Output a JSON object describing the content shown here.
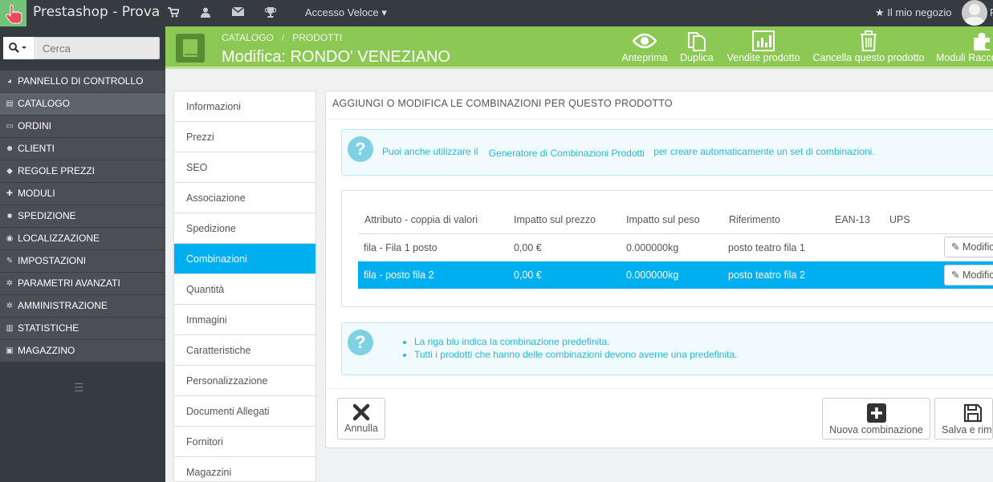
{
  "app": {
    "title": "Prestashop - Prova",
    "quick_access": "Accesso Veloce",
    "my_store": "Il mio negozio",
    "user_initial": "F"
  },
  "search": {
    "placeholder": "Cerca"
  },
  "sidebar": {
    "items": [
      {
        "label": "PANNELLO DI CONTROLLO",
        "icon": "dashboard-icon"
      },
      {
        "label": "CATALOGO",
        "icon": "book-icon"
      },
      {
        "label": "ORDINI",
        "icon": "credit-card-icon"
      },
      {
        "label": "CLIENTI",
        "icon": "users-icon"
      },
      {
        "label": "REGOLE PREZZI",
        "icon": "tags-icon"
      },
      {
        "label": "MODULI",
        "icon": "puzzle-icon"
      },
      {
        "label": "SPEDIZIONE",
        "icon": "truck-icon"
      },
      {
        "label": "LOCALIZZAZIONE",
        "icon": "globe-icon"
      },
      {
        "label": "IMPOSTAZIONI",
        "icon": "wrench-icon"
      },
      {
        "label": "PARAMETRI AVANZATI",
        "icon": "cogs-icon"
      },
      {
        "label": "AMMINISTRAZIONE",
        "icon": "cog-icon"
      },
      {
        "label": "STATISTICHE",
        "icon": "bar-chart-icon"
      },
      {
        "label": "MAGAZZINO",
        "icon": "archive-icon"
      }
    ],
    "active": "CATALOGO"
  },
  "header": {
    "breadcrumb": [
      "CATALOGO",
      "PRODOTTI"
    ],
    "title": "Modifica: RONDO' VENEZIANO",
    "toolbar": {
      "preview": "Anteprima",
      "duplicate": "Duplica",
      "sales": "Vendite prodotto",
      "delete": "Cancella questo prodotto",
      "modules": "Moduli Raccomandati"
    }
  },
  "tabs": [
    "Informazioni",
    "Prezzi",
    "SEO",
    "Associazione",
    "Spedizione",
    "Combinazioni",
    "Quantità",
    "Immagini",
    "Caratteristiche",
    "Personalizzazione",
    "Documenti Allegati",
    "Fornitori",
    "Magazzini"
  ],
  "panel": {
    "heading": "AGGIUNGI O MODIFICA LE COMBINAZIONI PER QUESTO PRODOTTO",
    "info1": {
      "before": "Puoi anche utilizzare il",
      "link": "Generatore di Combinazioni Prodotti",
      "after": "per creare automaticamente un set di combinazioni."
    },
    "table": {
      "headers": [
        "Attributo - coppia di valori",
        "Impatto sul prezzo",
        "Impatto sul peso",
        "Riferimento",
        "EAN-13",
        "UPS"
      ],
      "rows": [
        {
          "attr": "fila - Fila 1 posto",
          "price": "0,00 €",
          "weight": "0.000000kg",
          "ref": "posto teatro fila 1",
          "ean": "",
          "ups": "",
          "selected": false
        },
        {
          "attr": "fila - posto fila 2",
          "price": "0,00 €",
          "weight": "0.000000kg",
          "ref": "posto teatro fila 2",
          "ean": "",
          "ups": "",
          "selected": true
        }
      ],
      "edit_label": "Modifica"
    },
    "info2": [
      "La riga blu indica la combinazione predefinita.",
      "Tutti i prodotti che hanno delle combinazioni devono averne una predefinita."
    ],
    "buttons": {
      "cancel": "Annulla",
      "new": "Nuova combinazione",
      "save": "Salva e rimani"
    }
  },
  "colors": {
    "topbar": "#363a41",
    "header": "#8bc954",
    "accent": "#00aff0",
    "info": "#25b9d7"
  }
}
